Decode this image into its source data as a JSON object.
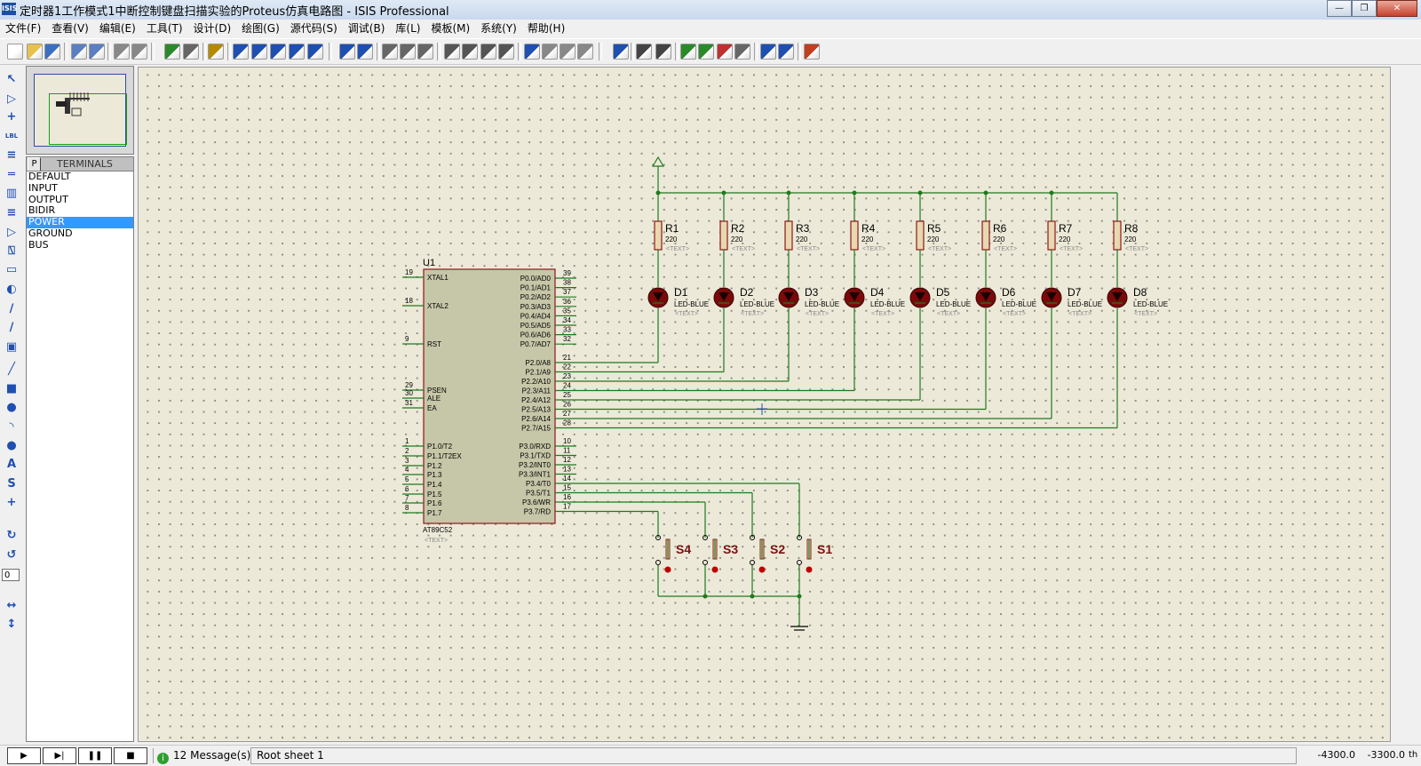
{
  "window": {
    "title": "定时器1工作模式1中断控制键盘扫描实验的Proteus仿真电路图 - ISIS Professional",
    "icon_text": "ISIS"
  },
  "menu": [
    "文件(F)",
    "查看(V)",
    "编辑(E)",
    "工具(T)",
    "设计(D)",
    "绘图(G)",
    "源代码(S)",
    "调试(B)",
    "库(L)",
    "模板(M)",
    "系统(Y)",
    "帮助(H)"
  ],
  "device_panel": {
    "mode_button": "P",
    "header": "TERMINALS",
    "items": [
      "DEFAULT",
      "INPUT",
      "OUTPUT",
      "BIDIR",
      "POWER",
      "GROUND",
      "BUS"
    ],
    "selected": "POWER"
  },
  "left_tools": {
    "rotation_value": "0"
  },
  "schematic": {
    "mcu": {
      "ref": "U1",
      "part": "AT89C52",
      "text": "<TEXT>",
      "left_pins": [
        {
          "num": "19",
          "name": "XTAL1"
        },
        {
          "num": "18",
          "name": "XTAL2"
        },
        {
          "num": "9",
          "name": "RST"
        },
        {
          "num": "29",
          "name": "PSEN"
        },
        {
          "num": "30",
          "name": "ALE"
        },
        {
          "num": "31",
          "name": "EA"
        },
        {
          "num": "1",
          "name": "P1.0/T2"
        },
        {
          "num": "2",
          "name": "P1.1/T2EX"
        },
        {
          "num": "3",
          "name": "P1.2"
        },
        {
          "num": "4",
          "name": "P1.3"
        },
        {
          "num": "5",
          "name": "P1.4"
        },
        {
          "num": "6",
          "name": "P1.5"
        },
        {
          "num": "7",
          "name": "P1.6"
        },
        {
          "num": "8",
          "name": "P1.7"
        }
      ],
      "right_pins": [
        {
          "num": "39",
          "name": "P0.0/AD0"
        },
        {
          "num": "38",
          "name": "P0.1/AD1"
        },
        {
          "num": "37",
          "name": "P0.2/AD2"
        },
        {
          "num": "36",
          "name": "P0.3/AD3"
        },
        {
          "num": "35",
          "name": "P0.4/AD4"
        },
        {
          "num": "34",
          "name": "P0.5/AD5"
        },
        {
          "num": "33",
          "name": "P0.6/AD6"
        },
        {
          "num": "32",
          "name": "P0.7/AD7"
        },
        {
          "num": "21",
          "name": "P2.0/A8"
        },
        {
          "num": "22",
          "name": "P2.1/A9"
        },
        {
          "num": "23",
          "name": "P2.2/A10"
        },
        {
          "num": "24",
          "name": "P2.3/A11"
        },
        {
          "num": "25",
          "name": "P2.4/A12"
        },
        {
          "num": "26",
          "name": "P2.5/A13"
        },
        {
          "num": "27",
          "name": "P2.6/A14"
        },
        {
          "num": "28",
          "name": "P2.7/A15"
        },
        {
          "num": "10",
          "name": "P3.0/RXD"
        },
        {
          "num": "11",
          "name": "P3.1/TXD"
        },
        {
          "num": "12",
          "name": "P3.2/INT0"
        },
        {
          "num": "13",
          "name": "P3.3/INT1"
        },
        {
          "num": "14",
          "name": "P3.4/T0"
        },
        {
          "num": "15",
          "name": "P3.5/T1"
        },
        {
          "num": "16",
          "name": "P3.6/WR"
        },
        {
          "num": "17",
          "name": "P3.7/RD"
        }
      ]
    },
    "resistors": [
      {
        "ref": "R1",
        "value": "220",
        "text": "<TEXT>"
      },
      {
        "ref": "R2",
        "value": "220",
        "text": "<TEXT>"
      },
      {
        "ref": "R3",
        "value": "220",
        "text": "<TEXT>"
      },
      {
        "ref": "R4",
        "value": "220",
        "text": "<TEXT>"
      },
      {
        "ref": "R5",
        "value": "220",
        "text": "<TEXT>"
      },
      {
        "ref": "R6",
        "value": "220",
        "text": "<TEXT>"
      },
      {
        "ref": "R7",
        "value": "220",
        "text": "<TEXT>"
      },
      {
        "ref": "R8",
        "value": "220",
        "text": "<TEXT>"
      }
    ],
    "leds": [
      {
        "ref": "D1",
        "part": "LED-BLUE",
        "text": "<TEXT>"
      },
      {
        "ref": "D2",
        "part": "LED-BLUE",
        "text": "<TEXT>"
      },
      {
        "ref": "D3",
        "part": "LED-BLUE",
        "text": "<TEXT>"
      },
      {
        "ref": "D4",
        "part": "LED-BLUE",
        "text": "<TEXT>"
      },
      {
        "ref": "D5",
        "part": "LED-BLUE",
        "text": "<TEXT>"
      },
      {
        "ref": "D6",
        "part": "LED-BLUE",
        "text": "<TEXT>"
      },
      {
        "ref": "D7",
        "part": "LED-BLUE",
        "text": "<TEXT>"
      },
      {
        "ref": "D8",
        "part": "LED-BLUE",
        "text": "<TEXT>"
      }
    ],
    "switches": [
      {
        "ref": "S4"
      },
      {
        "ref": "S3"
      },
      {
        "ref": "S2"
      },
      {
        "ref": "S1"
      }
    ],
    "colors": {
      "wire": "#1e7a1e",
      "body": "#c6c6a8",
      "outline": "#8b1a1a",
      "led": "#8b0000",
      "text": "#000080"
    }
  },
  "status": {
    "messages": "12 Message(s)",
    "sheet": "Root sheet 1",
    "x": "-4300.0",
    "y": "-3300.0",
    "units": "th"
  }
}
